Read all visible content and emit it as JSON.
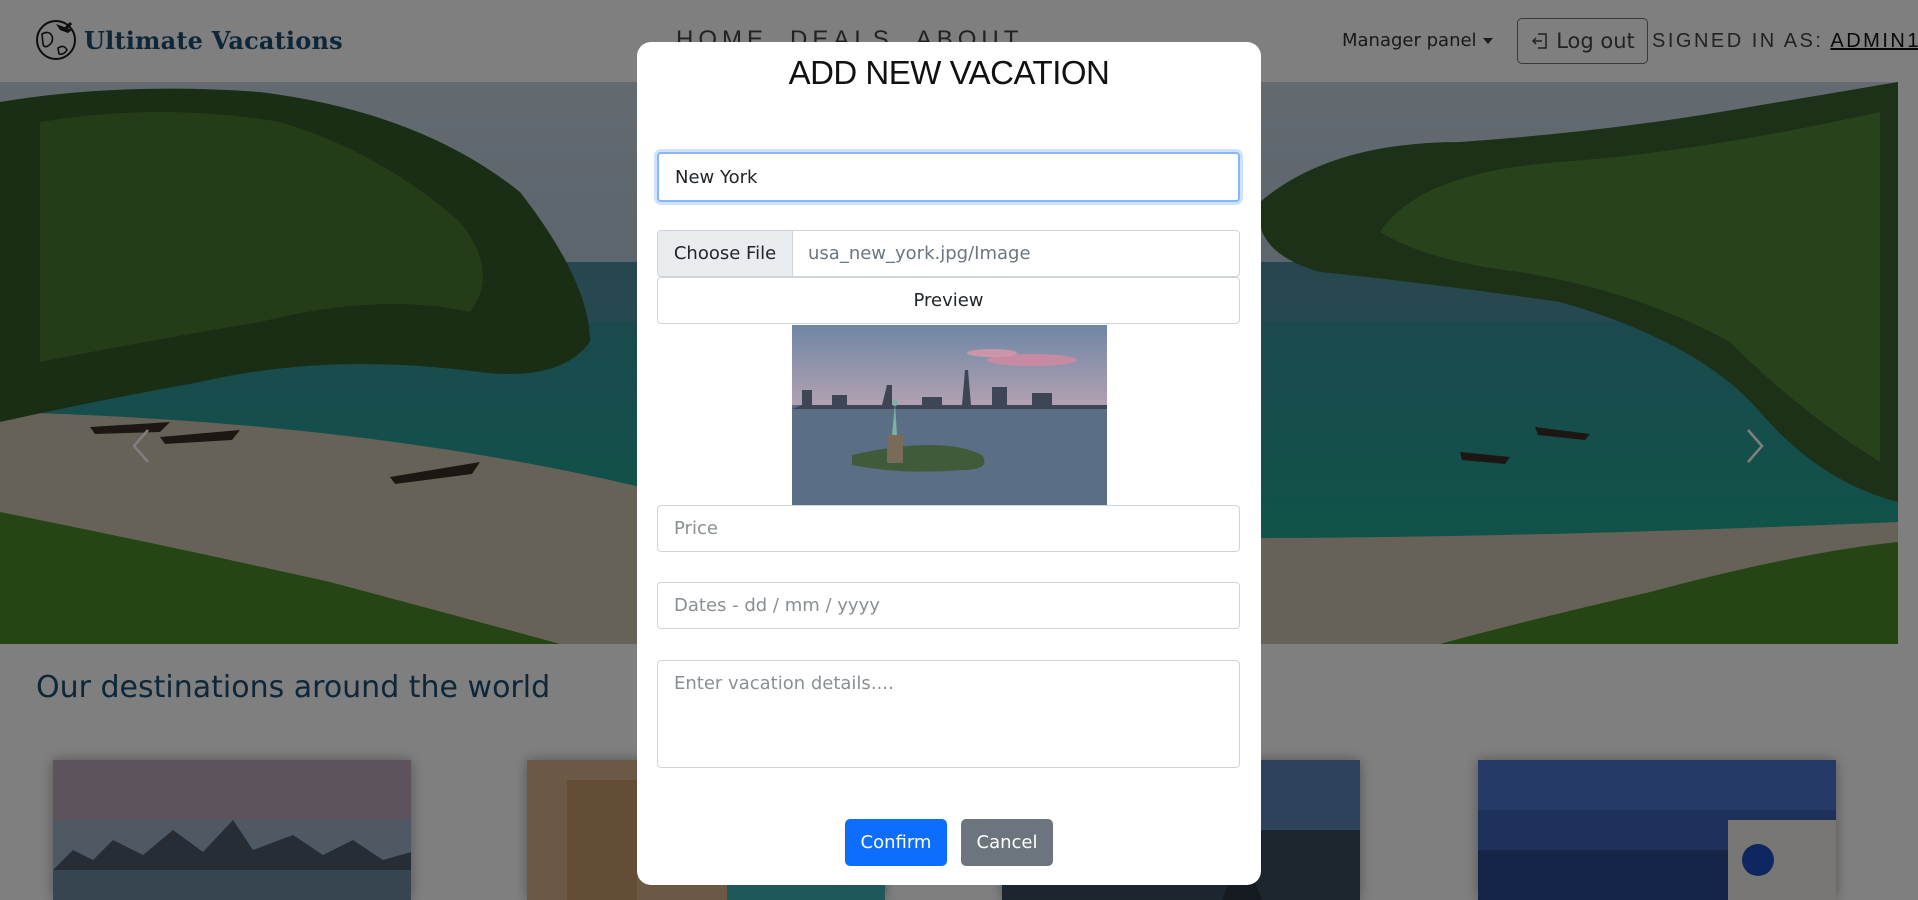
{
  "nav": {
    "brand": "Ultimate Vacations",
    "links": [
      "HOME",
      "DEALS",
      "ABOUT"
    ],
    "manager_panel": "Manager panel",
    "logout": "Log out",
    "signed_in_label": "SIGNED IN AS:",
    "user": "ADMIN1"
  },
  "main": {
    "section_title": "Our destinations around the world"
  },
  "modal": {
    "title": "ADD NEW VACATION",
    "destination_value": "New York",
    "choose_file_label": "Choose File",
    "file_name": "usa_new_york.jpg/Image",
    "preview_label": "Preview",
    "price_placeholder": "Price",
    "dates_placeholder": "Dates - dd / mm / yyyy",
    "details_placeholder": "Enter vacation details....",
    "confirm_label": "Confirm",
    "cancel_label": "Cancel"
  },
  "icons": {
    "logo": "globe-airplane-icon",
    "logout": "logout-arrow-icon",
    "caret": "chevron-down-icon",
    "carousel_prev": "chevron-left-icon",
    "carousel_next": "chevron-right-icon"
  },
  "colors": {
    "brand": "#1a4e72",
    "primary": "#0d6efd",
    "secondary": "#6c757d",
    "focus_border": "#86b7fe"
  }
}
